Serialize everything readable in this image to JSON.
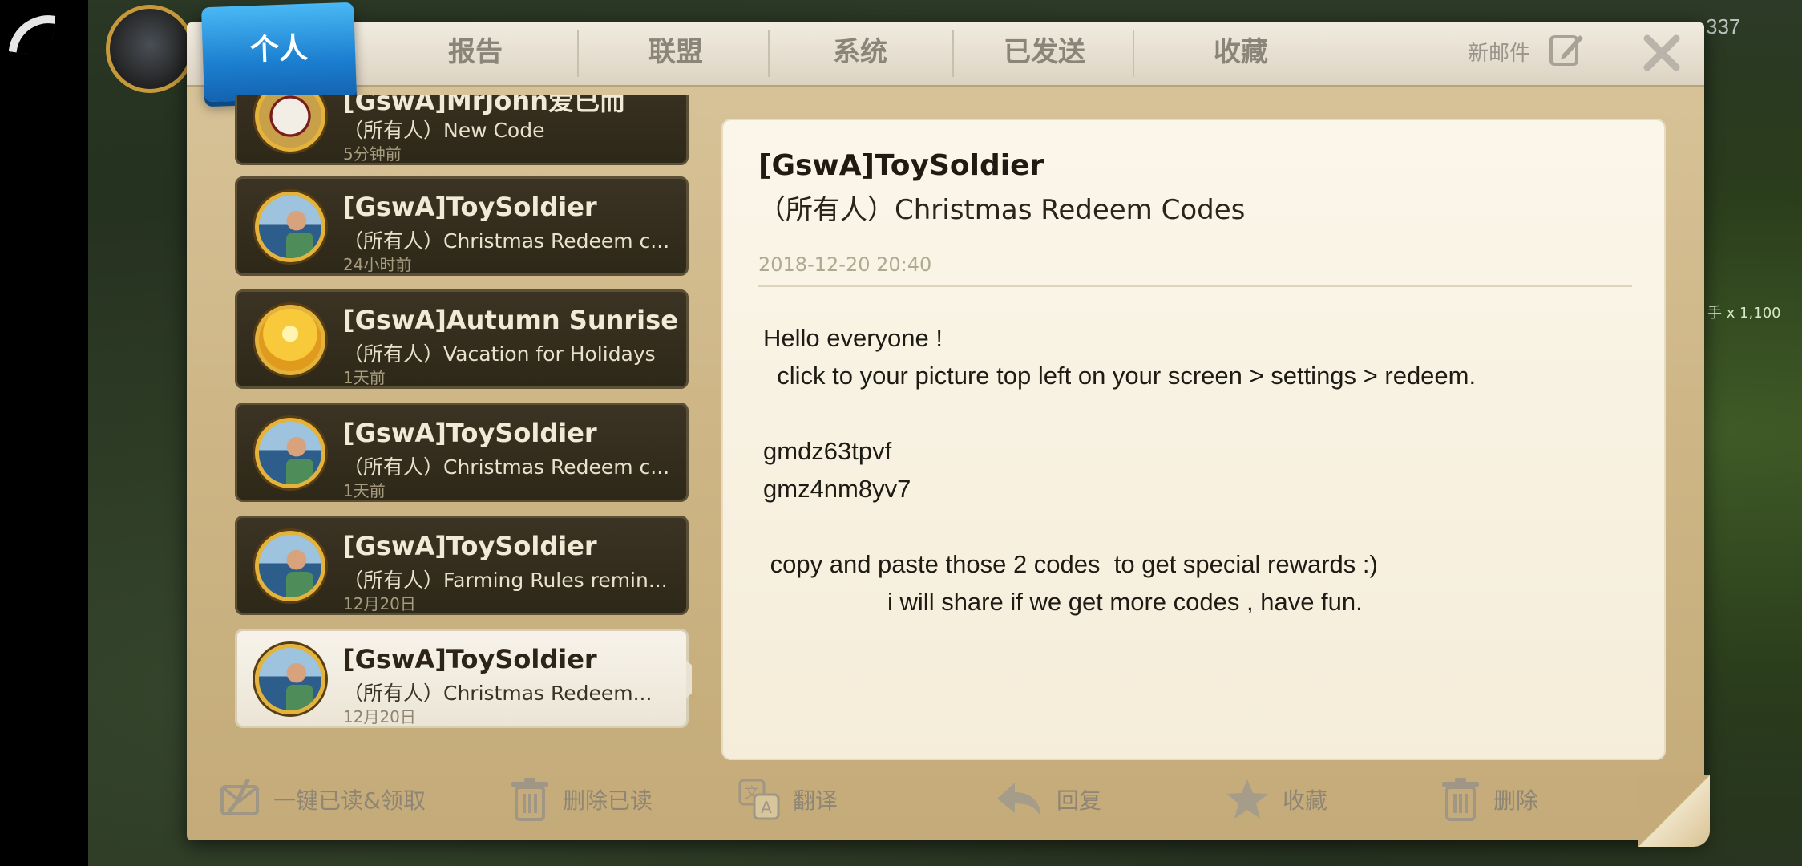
{
  "hud": {
    "resource_count": "337",
    "side_label": "手 x 1,100"
  },
  "tabs": [
    {
      "label": "个人",
      "active": true
    },
    {
      "label": "报告",
      "active": false
    },
    {
      "label": "联盟",
      "active": false
    },
    {
      "label": "系统",
      "active": false
    },
    {
      "label": "已发送",
      "active": false
    },
    {
      "label": "收藏",
      "active": false
    }
  ],
  "header": {
    "new_mail_label": "新邮件"
  },
  "mails": [
    {
      "sender": "[GswA]MrJohn爱已而",
      "subject": "（所有人）New Code",
      "time": "5分钟前",
      "avatar": "skull-avatar"
    },
    {
      "sender": "[GswA]ToySoldier",
      "subject": "（所有人）Christmas Redeem c...",
      "time": "24小时前",
      "avatar": "soldier-avatar"
    },
    {
      "sender": "[GswA]Autumn Sunrise",
      "subject": "（所有人）Vacation for Holidays",
      "time": "1天前",
      "avatar": "sunrise-avatar"
    },
    {
      "sender": "[GswA]ToySoldier",
      "subject": "（所有人）Christmas Redeem c...",
      "time": "1天前",
      "avatar": "soldier-avatar"
    },
    {
      "sender": "[GswA]ToySoldier",
      "subject": "（所有人）Farming Rules remin...",
      "time": "12月20日",
      "avatar": "soldier-avatar"
    },
    {
      "sender": "[GswA]ToySoldier",
      "subject": "（所有人）Christmas Redeem...",
      "time": "12月20日",
      "avatar": "soldier-avatar",
      "selected": true
    }
  ],
  "reader": {
    "sender": "[GswA]ToySoldier",
    "subject": "（所有人）Christmas Redeem Codes",
    "date": "2018-12-20 20:40",
    "body": "Hello everyone !\n  click to your picture top left on your screen > settings > redeem.\n\ngmdz63tpvf\ngmz4nm8yv7\n\n copy and paste those 2 codes  to get special rewards :)\n                  i will share if we get more codes , have fun."
  },
  "toolbar": {
    "read_all_label": "一键已读&领取",
    "delete_read_label": "删除已读",
    "translate_label": "翻译",
    "reply_label": "回复",
    "favorite_label": "收藏",
    "delete_label": "删除"
  }
}
